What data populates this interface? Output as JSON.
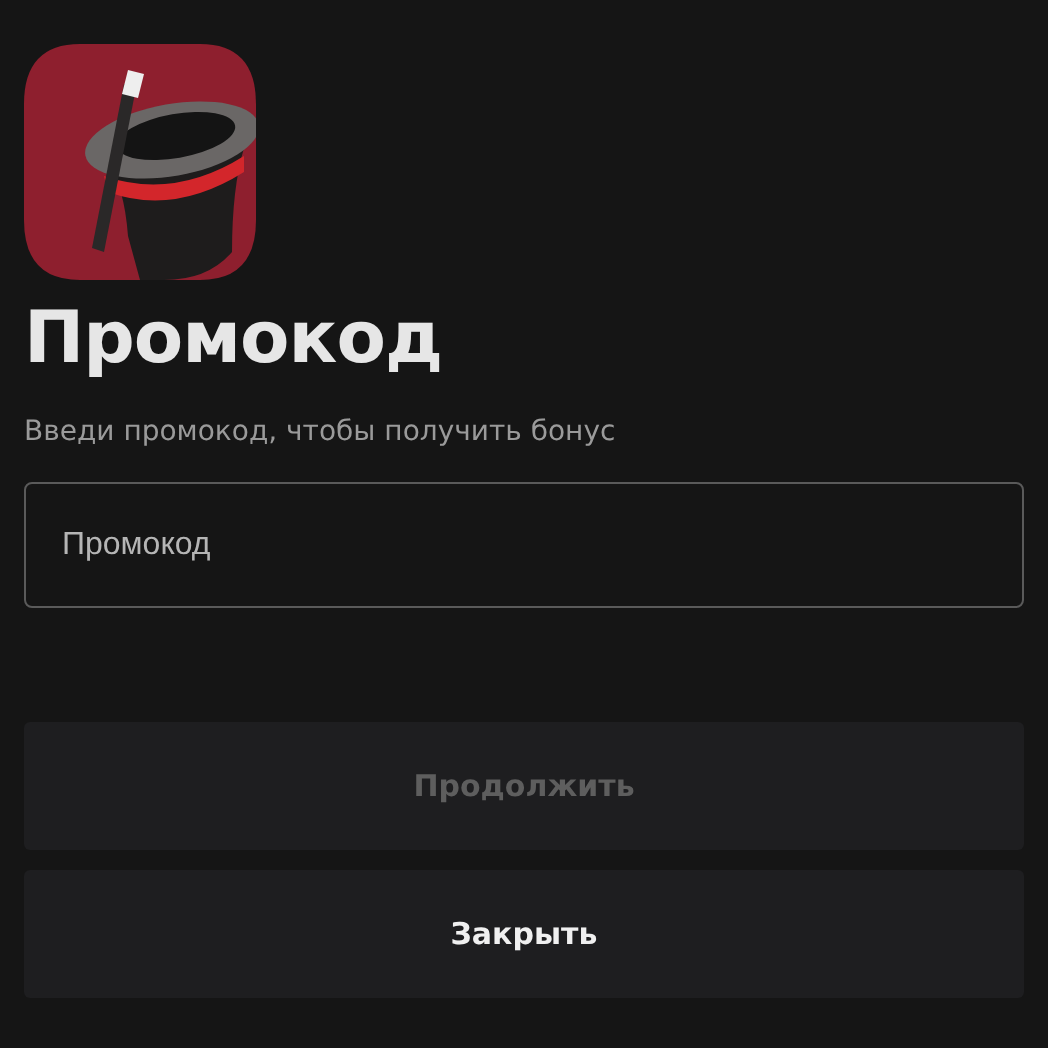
{
  "title": "Промокод",
  "subtitle": "Введи промокод, чтобы получить бонус",
  "promo_field": {
    "placeholder": "Промокод"
  },
  "buttons": [
    {
      "label": "Продолжить",
      "disabled": true
    },
    {
      "label": "Закрыть",
      "disabled": false
    }
  ]
}
